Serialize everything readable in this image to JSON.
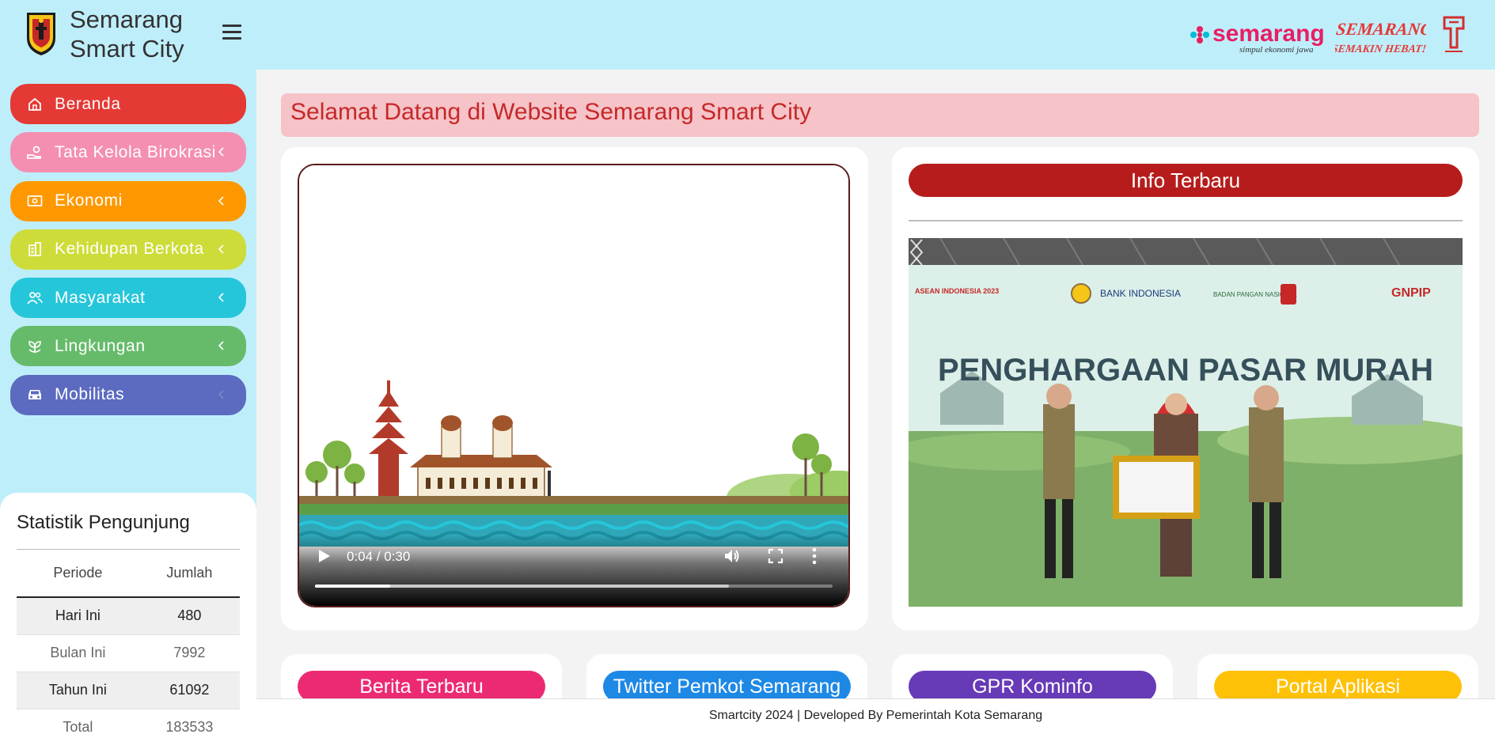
{
  "brand": {
    "title_line1": "Semarang",
    "title_line2": "Smart City",
    "logo": "city-crest-logo",
    "menu_icon": "hamburger-icon"
  },
  "header": {
    "partner_logos": [
      {
        "name": "semarang-tourism-logo",
        "text": "semarang",
        "tagline": "simpul ekonomi jawa"
      },
      {
        "name": "semarang-semakin-hebat-logo",
        "text": "SEMARANG",
        "tagline": "SEMAKIN HEBAT!"
      },
      {
        "name": "government-emblem-logo"
      }
    ]
  },
  "sidebar": {
    "items": [
      {
        "label": "Beranda",
        "icon": "home-icon",
        "color": "#e53935",
        "chevron": false
      },
      {
        "label": "Tata Kelola Birokrasi",
        "icon": "hand-coin-icon",
        "color": "#f48fb1",
        "chevron": true
      },
      {
        "label": "Ekonomi",
        "icon": "money-icon",
        "color": "#ff9800",
        "chevron": true
      },
      {
        "label": "Kehidupan Berkota",
        "icon": "building-icon",
        "color": "#cddc39",
        "chevron": true
      },
      {
        "label": "Masyarakat",
        "icon": "people-icon",
        "color": "#26c6da",
        "chevron": true
      },
      {
        "label": "Lingkungan",
        "icon": "plant-icon",
        "color": "#66bb6a",
        "chevron": true
      },
      {
        "label": "Mobilitas",
        "icon": "car-icon",
        "color": "#5c6bc0",
        "chevron": true
      }
    ]
  },
  "stats": {
    "title": "Statistik Pengunjung",
    "headers": [
      "Periode",
      "Jumlah"
    ],
    "rows": [
      {
        "periode": "Hari Ini",
        "jumlah": "480"
      },
      {
        "periode": "Bulan Ini",
        "jumlah": "7992"
      },
      {
        "periode": "Tahun Ini",
        "jumlah": "61092"
      },
      {
        "periode": "Total",
        "jumlah": "183533"
      }
    ]
  },
  "welcome": "Selamat Datang di Website Semarang Smart City",
  "video": {
    "time": "0:04 / 0:30",
    "played_fraction": 0.145,
    "buffered_fraction": 0.8
  },
  "info": {
    "title": "Info Terbaru",
    "banner_text": "PENGHARGAAN PASAR MURAH",
    "sponsors": [
      "ASEAN INDONESIA 2023",
      "BANK INDONESIA",
      "BADAN PANGAN NASIONAL",
      "GNPIP"
    ]
  },
  "cards": [
    {
      "label": "Berita Terbaru",
      "color": "#ec2a74"
    },
    {
      "label": "Twitter Pemkot Semarang",
      "color": "#1e88e5"
    },
    {
      "label": "GPR Kominfo",
      "color": "#673ab7"
    },
    {
      "label": "Portal Aplikasi",
      "color": "#ffc107"
    }
  ],
  "footer": "Smartcity 2024 | Developed By Pemerintah Kota Semarang"
}
